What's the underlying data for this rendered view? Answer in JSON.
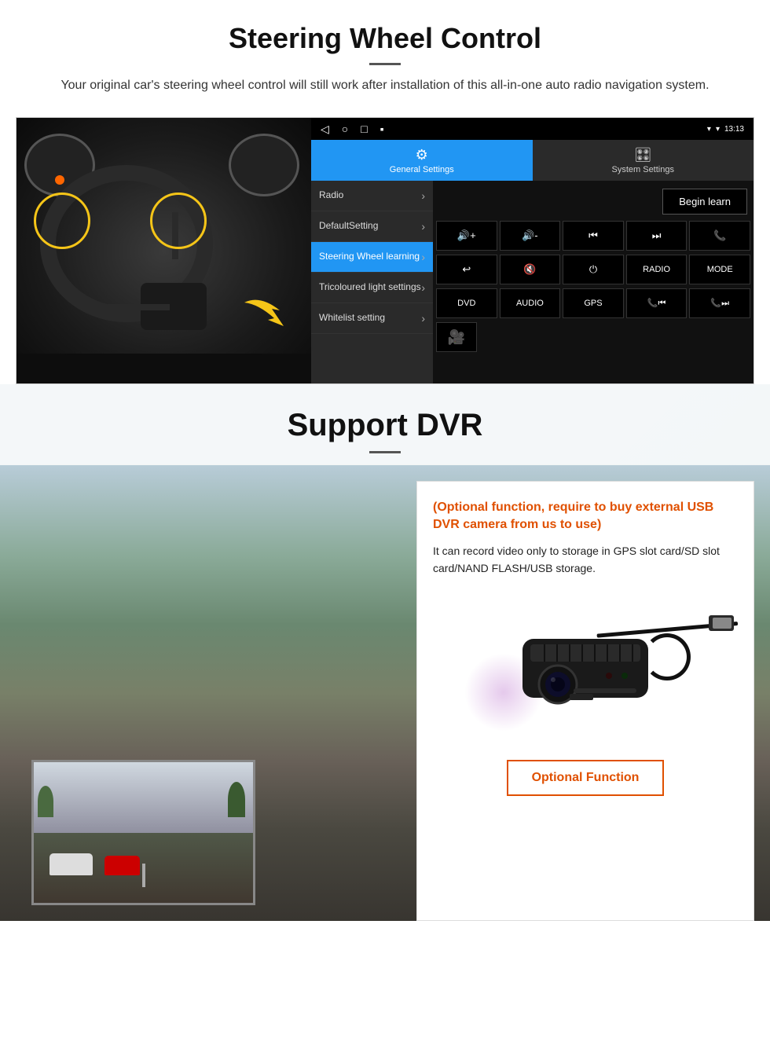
{
  "page": {
    "steering_section": {
      "title": "Steering Wheel Control",
      "subtitle": "Your original car's steering wheel control will still work after installation of this all-in-one auto radio navigation system."
    },
    "android_ui": {
      "statusbar": {
        "time": "13:13",
        "nav_icons": [
          "◁",
          "○",
          "□",
          "▪"
        ]
      },
      "tabs": [
        {
          "label": "General Settings",
          "active": true,
          "icon": "⚙"
        },
        {
          "label": "System Settings",
          "active": false,
          "icon": "🎛"
        }
      ],
      "menu_items": [
        {
          "label": "Radio",
          "active": false
        },
        {
          "label": "DefaultSetting",
          "active": false
        },
        {
          "label": "Steering Wheel learning",
          "active": true
        },
        {
          "label": "Tricoloured light settings",
          "active": false
        },
        {
          "label": "Whitelist setting",
          "active": false
        }
      ],
      "begin_learn_btn": "Begin learn",
      "control_buttons_row1": [
        "🔊+",
        "🔊-",
        "⏮",
        "⏭",
        "📞"
      ],
      "control_buttons_row2": [
        "↩",
        "🔇",
        "⏻",
        "RADIO",
        "MODE"
      ],
      "control_buttons_row3": [
        "DVD",
        "AUDIO",
        "GPS",
        "📞⏮",
        "📞⏭"
      ],
      "control_icon": "📷"
    },
    "dvr_section": {
      "title": "Support DVR",
      "optional_text": "(Optional function, require to buy external USB DVR camera from us to use)",
      "description": "It can record video only to storage in GPS slot card/SD slot card/NAND FLASH/USB storage.",
      "optional_function_btn": "Optional Function"
    }
  }
}
